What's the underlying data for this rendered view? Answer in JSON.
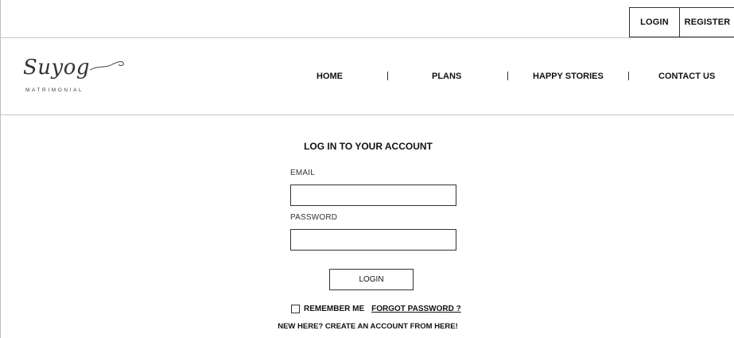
{
  "topbar": {
    "login_label": "LOGIN",
    "register_label": "REGISTER"
  },
  "brand": {
    "name": "Suyog",
    "tagline": "MATRIMONIAL"
  },
  "nav": {
    "items": [
      {
        "label": "HOME"
      },
      {
        "label": "PLANS"
      },
      {
        "label": "HAPPY STORIES"
      },
      {
        "label": "CONTACT US"
      }
    ],
    "separator": "|"
  },
  "login_form": {
    "title": "LOG IN TO YOUR ACCOUNT",
    "email_label": "EMAIL",
    "email_value": "",
    "password_label": "PASSWORD",
    "password_value": "",
    "submit_label": "LOGIN",
    "remember_label": "REMEMBER ME",
    "remember_checked": false,
    "forgot_label": "FORGOT PASSWORD ?",
    "signup_text": "NEW HERE? CREATE AN ACCOUNT FROM HERE!"
  },
  "colors": {
    "border": "#333333",
    "divider": "#c8c8c8",
    "text": "#111111",
    "background": "#ffffff"
  }
}
